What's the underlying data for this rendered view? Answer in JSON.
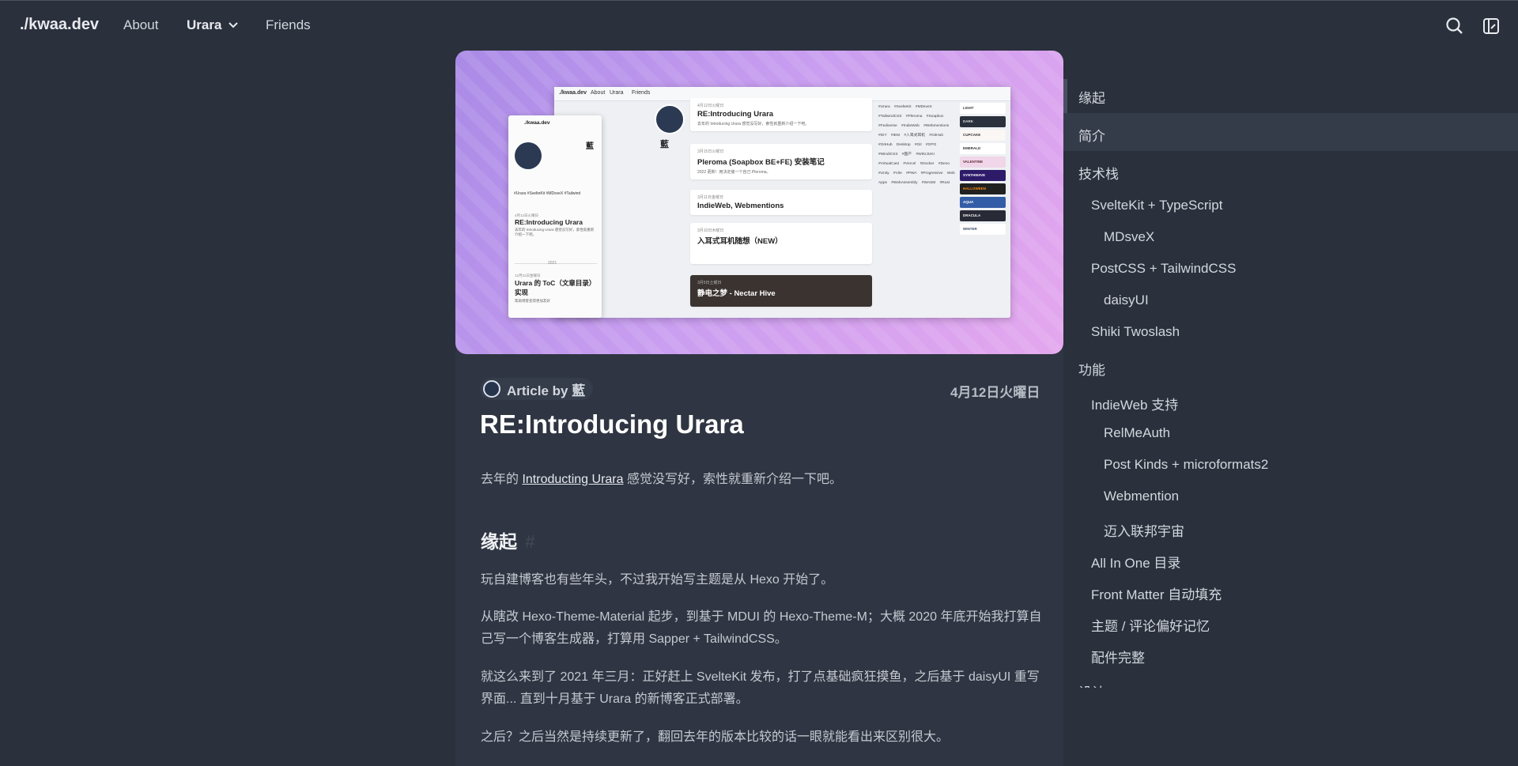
{
  "nav": {
    "brand": "./kwaa.dev",
    "about": "About",
    "urara": "Urara",
    "friends": "Friends"
  },
  "hero_shot": {
    "nav_brand": "./kwaa.dev",
    "nav_about": "About",
    "nav_urara": "Urara",
    "nav_friends": "Friends",
    "name": "藍",
    "posts": [
      {
        "date": "4月12日火曜日",
        "title": "RE:Introducing Urara",
        "summary": "去年的 Introducing Urara 感觉没写好，索性就重新介绍一下吧。"
      },
      {
        "date": "3月15日火曜日",
        "title": "Pleroma (Soapbox BE+FE) 安装笔记",
        "summary": "2022 更新！用决定装一个自己 Pleroma。"
      },
      {
        "date": "3月11日金曜日",
        "title": "IndieWeb, Webmentions",
        "summary": ""
      },
      {
        "date": "3月10日木曜日",
        "title": "入耳式耳机随想（NEW）",
        "summary": ""
      },
      {
        "date": "3月5日土曜日",
        "title": "静电之梦 - Nectar Hive",
        "summary": ""
      }
    ],
    "tags": "#Urara #SvelteKit #MDsveX #TailwindCSS #Pleroma #Soapbox #Fediverse #IndieWeb #Webmentions #DIY #IEM #入耳式耳机 #GitHub #GitHub Desktop #Git #GPG #WindiCSS #国产 #WIKIJUKI #VirtualCast #Vercel #Docker #Deno #Unity #Vite #PWA #Progressive Web Apps #WebAssembly #WASM #Rust",
    "themes": [
      "LIGHT",
      "DARK",
      "CUPCAKE",
      "EMERALD",
      "VALENTINE",
      "SYNTHWAVE",
      "HALLOWEEN",
      "AQUA",
      "DRACULA",
      "WINTER"
    ],
    "mobile_tags": "#Urara #SvelteKit #MDsveX #Tailwind",
    "mobile_post1_date": "4月12日火曜日",
    "mobile_post1_title": "RE:Introducing Urara",
    "mobile_post1_summary": "去年的 Introducing Urara 感觉没写好，索性就重新介绍一下吧。",
    "mobile_year": "2021",
    "mobile_post2_date": "12月31日金曜日",
    "mobile_post2_title": "Urara 的 ToC（文章目录）实现",
    "mobile_post2_summary": "帮助博客变得更加友好"
  },
  "article": {
    "byline": "Article by 藍",
    "date": "4月12日火曜日",
    "title": "RE:Introducing Urara",
    "lead_prefix": "去年的 ",
    "lead_link": "Introducting Urara",
    "lead_suffix": " 感觉没写好，索性就重新介绍一下吧。",
    "h2": "缘起",
    "h2_hash": "#",
    "paragraphs": [
      "玩自建博客也有些年头，不过我开始写主题是从 Hexo 开始了。",
      "从瞎改 Hexo-Theme-Material 起步，到基于 MDUI 的 Hexo-Theme-M；大概 2020 年底开始我打算自己写一个博客生成器，打算用 Sapper + TailwindCSS。",
      "就这么来到了 2021 年三月：正好赶上 SvelteKit 发布，打了点基础疯狂摸鱼，之后基于 daisyUI 重写界面... 直到十月基于 Urara 的新博客正式部署。",
      "之后？之后当然是持续更新了，翻回去年的版本比较的话一眼就能看出来区别很大。"
    ]
  },
  "toc": [
    {
      "label": "缘起",
      "level": 1
    },
    {
      "label": "简介",
      "level": 1
    },
    {
      "label": "技术栈",
      "level": 1
    },
    {
      "label": "SvelteKit + TypeScript",
      "level": 2
    },
    {
      "label": "MDsveX",
      "level": 3
    },
    {
      "label": "PostCSS + TailwindCSS",
      "level": 2
    },
    {
      "label": "daisyUI",
      "level": 3
    },
    {
      "label": "Shiki Twoslash",
      "level": 2
    },
    {
      "label": "功能",
      "level": 1
    },
    {
      "label": "IndieWeb 支持",
      "level": 2
    },
    {
      "label": "RelMeAuth",
      "level": 3
    },
    {
      "label": "Post Kinds + microformats2",
      "level": 3
    },
    {
      "label": "Webmention",
      "level": 3
    },
    {
      "label": "迈入联邦宇宙",
      "level": 3
    },
    {
      "label": "All In One 目录",
      "level": 2
    },
    {
      "label": "Front Matter 自动填充",
      "level": 2
    },
    {
      "label": "主题 / 评论偏好记忆",
      "level": 2
    },
    {
      "label": "配件完整",
      "level": 2
    },
    {
      "label": "设计",
      "level": 1
    }
  ],
  "colors": {
    "background": "#2a303c",
    "card": "#2f3542",
    "hero_start": "#a98ae6",
    "hero_end": "#e4a7ee"
  }
}
